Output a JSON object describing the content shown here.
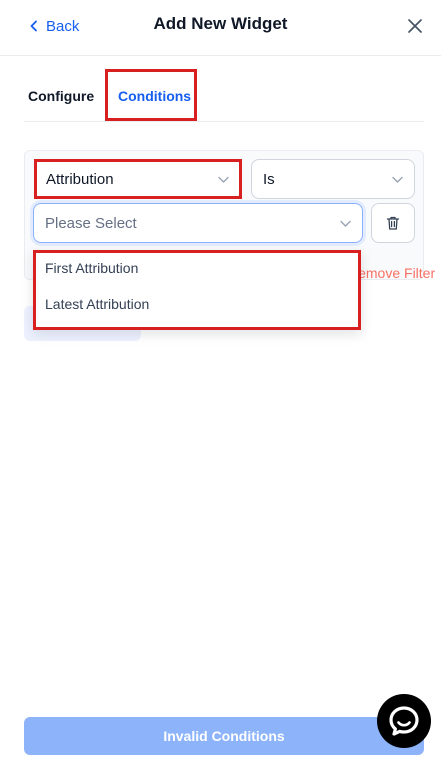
{
  "header": {
    "back_label": "Back",
    "title": "Add New Widget"
  },
  "tabs": [
    {
      "label": "Configure",
      "active": false
    },
    {
      "label": "Conditions",
      "active": true
    }
  ],
  "condition": {
    "field_value": "Attribution",
    "operator_value": "Is",
    "value_placeholder": "Please Select",
    "remove_label": "Remove Filter",
    "dropdown_options": [
      "First Attribution",
      "Latest Attribution"
    ]
  },
  "footer": {
    "submit_label": "Invalid Conditions"
  },
  "colors": {
    "accent": "#155eef",
    "highlight": "#d92020",
    "disabled_button": "#8db4fb",
    "danger_text": "#f97066"
  }
}
